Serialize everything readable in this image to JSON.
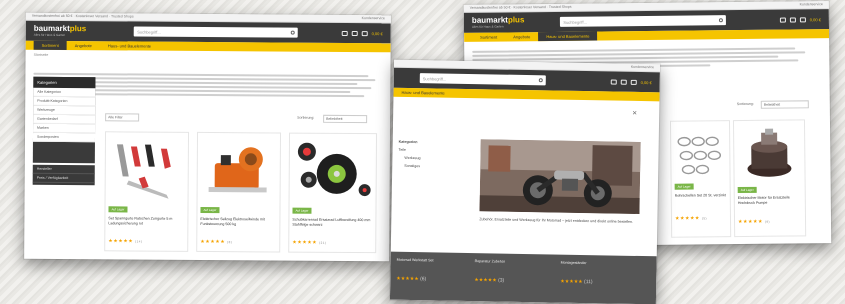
{
  "brand": {
    "name_main": "baumarkt",
    "name_accent": "plus",
    "tagline": "Alles für Haus & Garten",
    "accent": "#f5c400",
    "dark": "#3a3a3a"
  },
  "topbar": {
    "left": "Versandkostenfrei ab 50 € · Kostenloser Versand · Trusted Shops",
    "right": "Kundenservice"
  },
  "search": {
    "placeholder": "Suchbegriff..."
  },
  "header": {
    "cart_label": "0,00 €"
  },
  "window_left": {
    "nav": [
      "Sortiment",
      "Angebote",
      "Haus- und Bauelemente"
    ],
    "breadcrumb": "Startseite",
    "sidebar": {
      "head": "Kategorien",
      "items": [
        "Alle Kategorien",
        "Produkt-Kategorien",
        "Werkzeuge",
        "Gartenbedarf",
        "Marken",
        "Sonderposten"
      ],
      "extra": [
        "Hersteller",
        "Preis / Verfügbarkeit"
      ]
    },
    "toolbar": {
      "filter": "Alle Filter",
      "sort_label": "Sortierung:",
      "sort_value": "Beliebtheit"
    },
    "products": [
      {
        "badge": "Auf Lager",
        "title": "Set Spanngurte Ratschen Zurrgurte 5 m Ladungssicherung rot",
        "reviews": "(14)"
      },
      {
        "badge": "Auf Lager",
        "title": "Elektrischer Seilzug Elektroseilwinde mit Funksteuerung 500 kg",
        "reviews": "(8)"
      },
      {
        "badge": "Auf Lager",
        "title": "Schubkarrenrad Ersatzrad Luftbereifung 400 mm Stahlfelge schwarz",
        "reviews": "(21)"
      }
    ]
  },
  "window_mid": {
    "nav": [
      "Haus- und Bauelemente"
    ],
    "sidebar": {
      "items": [
        "Kategorien",
        "Teile",
        "Werkzeug",
        "Sonstiges"
      ]
    },
    "caption": "Zubehör, Ersatzteile und Werkzeug für Ihr Motorrad – jetzt entdecken und direkt online bestellen.",
    "bottom_titles": [
      "Motorrad Werkstatt Set",
      "Reparatur Zubehör",
      "Montageständer"
    ],
    "bottom_reviews": [
      "(6)",
      "(3)",
      "(11)"
    ]
  },
  "window_right": {
    "nav": [
      "Sortiment",
      "Angebote",
      "Haus- und Bauelemente"
    ],
    "sort_label": "Sortierung:",
    "sort_value": "Beliebtheit",
    "products": [
      {
        "badge": "Auf Lager",
        "title": "Rohrschellen Set 20 St. verzinkt",
        "reviews": "(5)"
      },
      {
        "badge": "Auf Lager",
        "title": "Elektrischer Motor für Ersatzteile Hochdruck Pumpe",
        "reviews": "(9)"
      }
    ]
  }
}
